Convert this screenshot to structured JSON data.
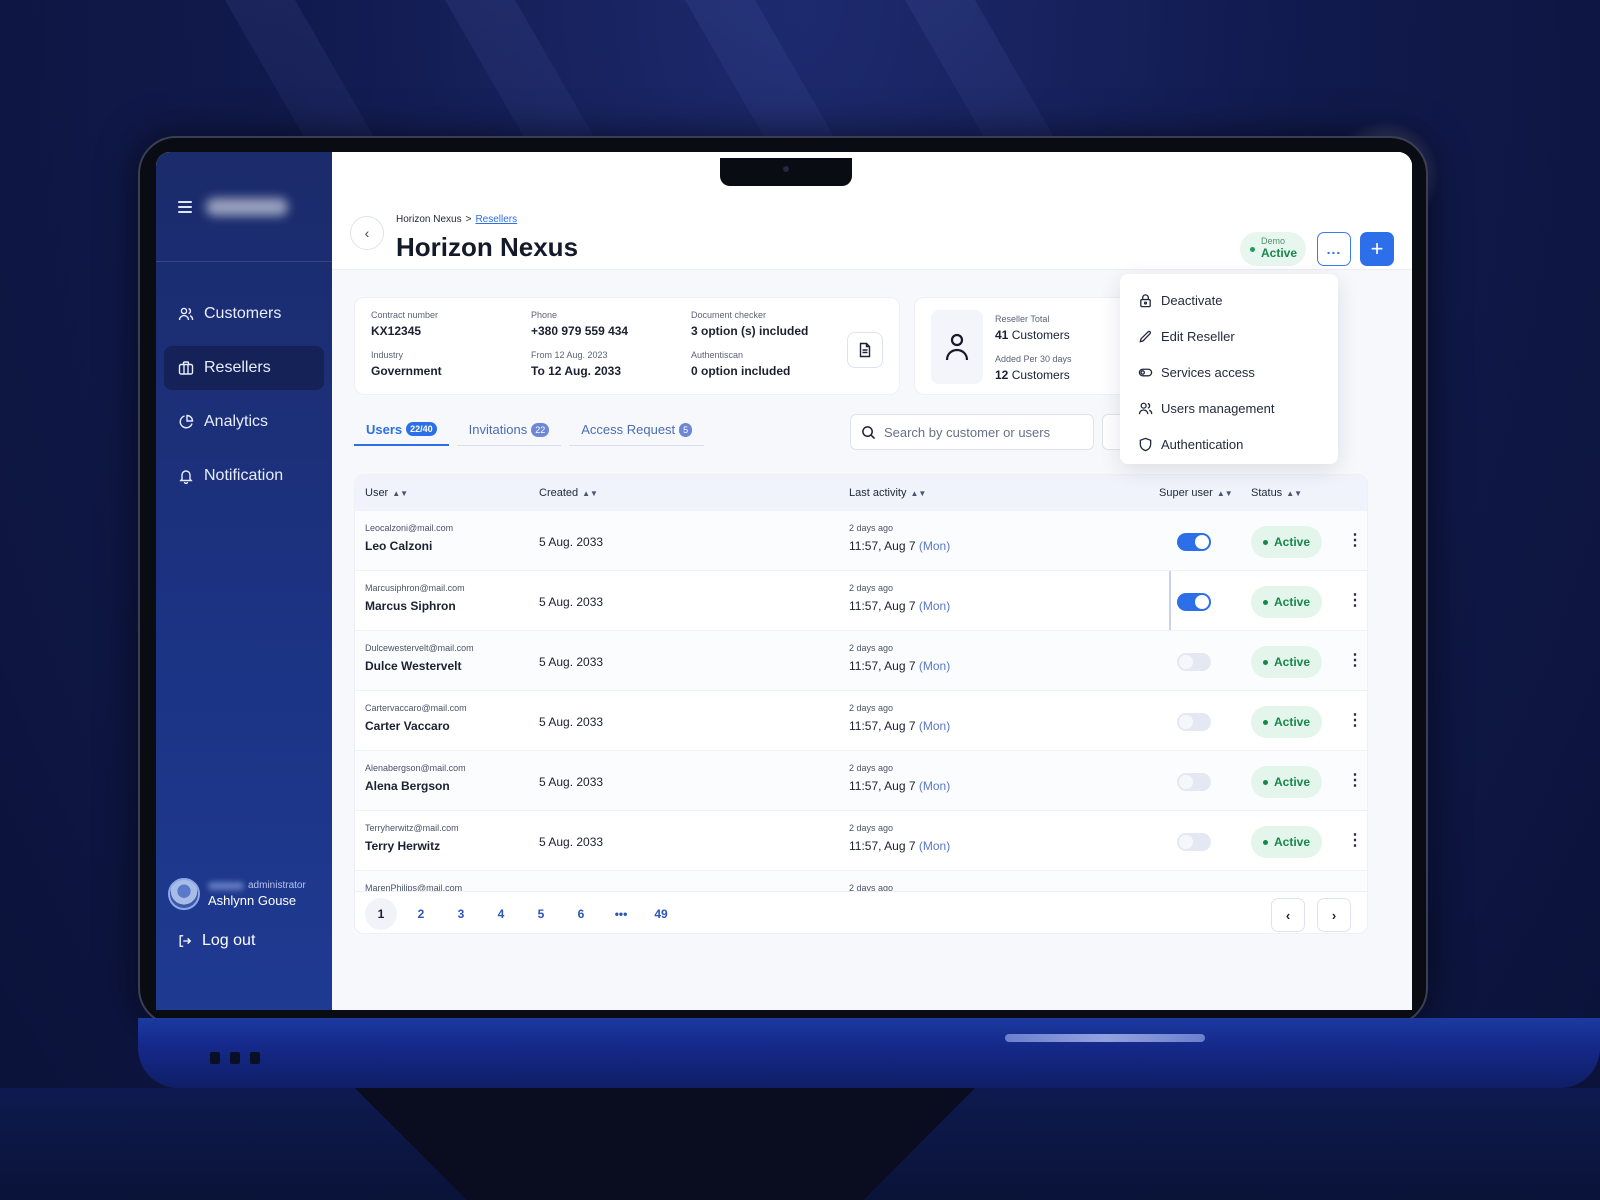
{
  "sidebar": {
    "items": [
      {
        "label": "Customers",
        "icon": "users-icon"
      },
      {
        "label": "Resellers",
        "icon": "briefcase-icon"
      },
      {
        "label": "Analytics",
        "icon": "pie-chart-icon"
      },
      {
        "label": "Notification",
        "icon": "bell-icon"
      }
    ],
    "active_index": 1,
    "user": {
      "role": "administrator",
      "name": "Ashlynn Gouse"
    },
    "logout_label": "Log out"
  },
  "header": {
    "breadcrumb": {
      "root": "Horizon Nexus",
      "separator": ">",
      "current": "Resellers"
    },
    "title": "Horizon Nexus",
    "status": {
      "top": "Demo",
      "bottom": "Active"
    },
    "more_label": "...",
    "add_label": "+"
  },
  "info": {
    "contract_label": "Contract number",
    "contract": "KX12345",
    "industry_label": "Industry",
    "industry": "Government",
    "phone_label": "Phone",
    "phone": "+380 979 559 434",
    "from_label": "From 12 Aug. 2023",
    "to": "To 12 Aug. 2033",
    "doc_checker_label": "Document checker",
    "doc_checker": "3 option (s) included",
    "authentiscan_label": "Authentiscan",
    "authentiscan": "0 option included"
  },
  "reseller": {
    "total_label": "Reseller Total",
    "total_num": "41",
    "total_unit": "Customers",
    "added_label": "Added Per 30 days",
    "added_num": "12",
    "added_unit": "Customers"
  },
  "menu": [
    {
      "label": "Deactivate",
      "icon": "lock-icon"
    },
    {
      "label": "Edit Reseller",
      "icon": "pencil-icon"
    },
    {
      "label": "Services access",
      "icon": "toggle-icon"
    },
    {
      "label": "Users management",
      "icon": "users-icon"
    },
    {
      "label": "Authentication",
      "icon": "shield-icon"
    }
  ],
  "tabs": [
    {
      "label": "Users",
      "badge": "22/40"
    },
    {
      "label": "Invitations",
      "badge": "22"
    },
    {
      "label": "Access Request",
      "badge": "5"
    }
  ],
  "search": {
    "placeholder": "Search by customer or users"
  },
  "table": {
    "columns": [
      "User",
      "Created",
      "Last activity",
      "Super user",
      "Status"
    ],
    "rows": [
      {
        "email": "Leocalzoni@mail.com",
        "name": "Leo Calzoni",
        "created": "5 Aug. 2033",
        "ago": "2 days ago",
        "time": "11:57, Aug 7",
        "day": "(Mon)",
        "super": true,
        "status": "Active"
      },
      {
        "email": "Marcusiphron@mail.com",
        "name": "Marcus Siphron",
        "created": "5 Aug. 2033",
        "ago": "2 days ago",
        "time": "11:57, Aug 7",
        "day": "(Mon)",
        "super": true,
        "status": "Active"
      },
      {
        "email": "Dulcewestervelt@mail.com",
        "name": "Dulce Westervelt",
        "created": "5 Aug. 2033",
        "ago": "2 days ago",
        "time": "11:57, Aug 7",
        "day": "(Mon)",
        "super": false,
        "status": "Active"
      },
      {
        "email": "Cartervaccaro@mail.com",
        "name": "Carter Vaccaro",
        "created": "5 Aug. 2033",
        "ago": "2 days ago",
        "time": "11:57, Aug 7",
        "day": "(Mon)",
        "super": false,
        "status": "Active"
      },
      {
        "email": "Alenabergson@mail.com",
        "name": "Alena Bergson",
        "created": "5 Aug. 2033",
        "ago": "2 days ago",
        "time": "11:57, Aug 7",
        "day": "(Mon)",
        "super": false,
        "status": "Active"
      },
      {
        "email": "Terryherwitz@mail.com",
        "name": "Terry Herwitz",
        "created": "5 Aug. 2033",
        "ago": "2 days ago",
        "time": "11:57, Aug 7",
        "day": "(Mon)",
        "super": false,
        "status": "Active"
      },
      {
        "email": "MarenPhilips@mail.com",
        "name": "",
        "created": "",
        "ago": "2 days ago",
        "time": "",
        "day": "",
        "super": false,
        "status": ""
      }
    ]
  },
  "pagination": {
    "pages": [
      "1",
      "2",
      "3",
      "4",
      "5",
      "6",
      "•••",
      "49"
    ],
    "current": "1",
    "prev": "‹",
    "next": "›"
  },
  "colors": {
    "accent": "#2c6fe8",
    "sidebar": "#1c3383",
    "success": "#17874b"
  }
}
